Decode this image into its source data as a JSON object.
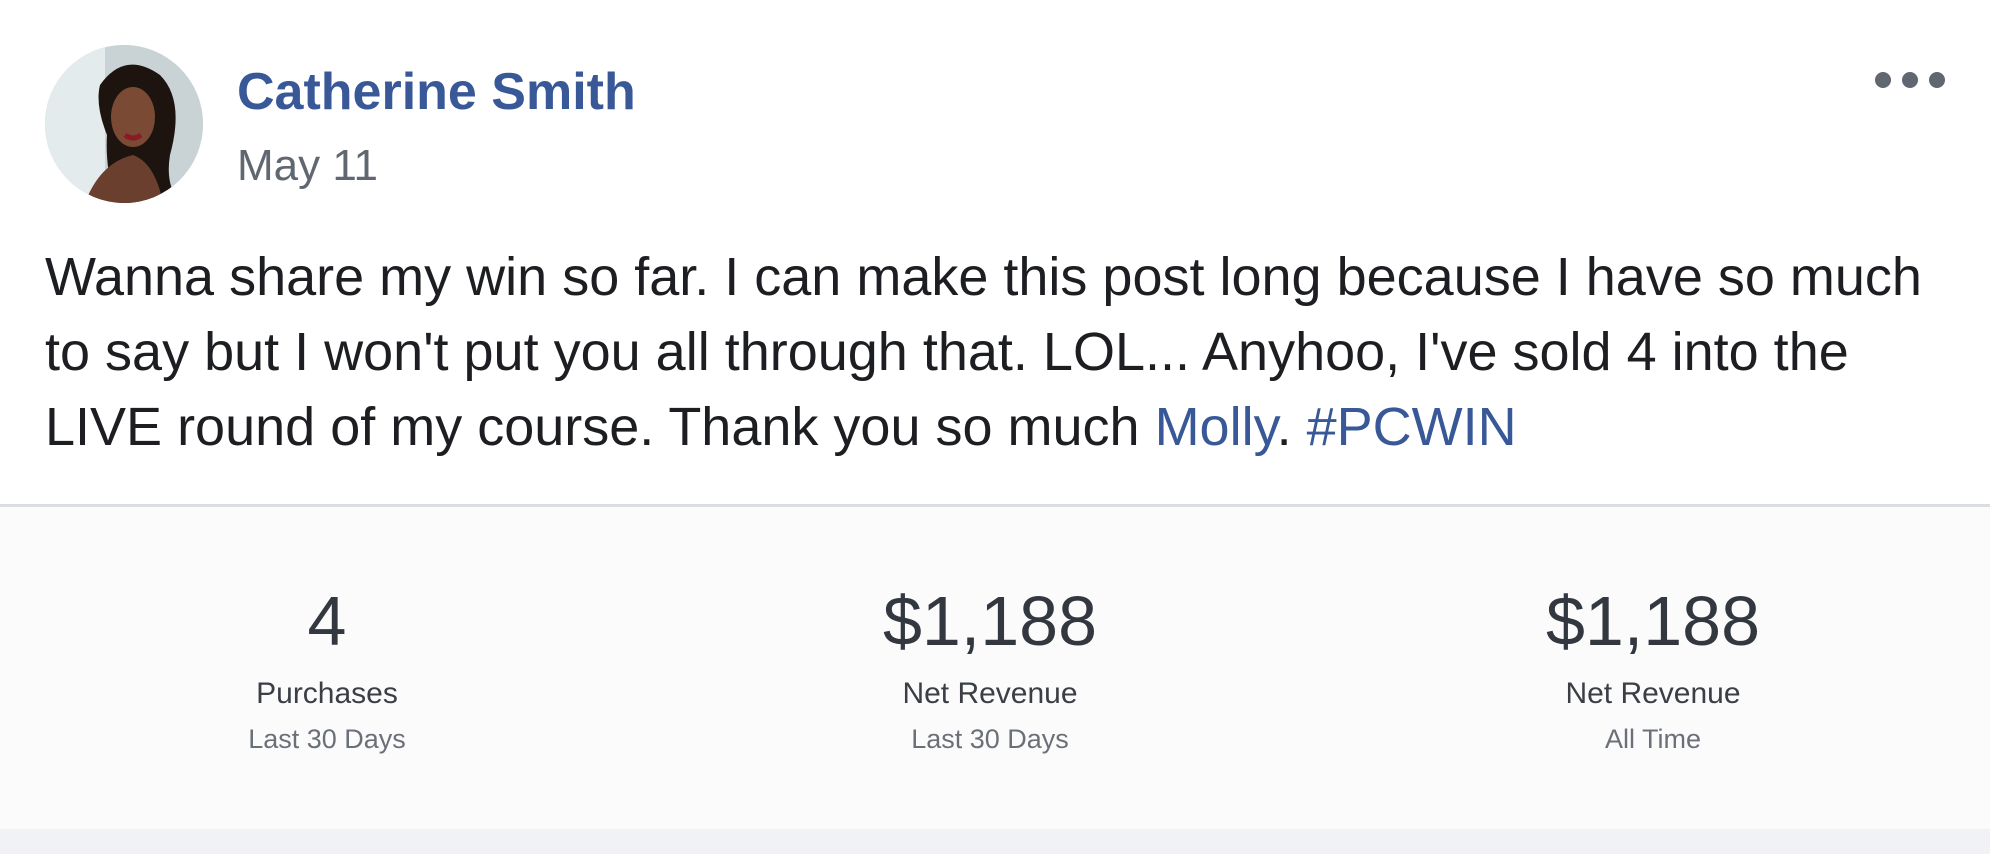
{
  "post": {
    "author": "Catherine Smith",
    "date": "May 11",
    "body_before_link": "Wanna share my win so far. I can make this post long because I have so much to say but I won't put you all through that. LOL... Anyhoo, I've sold 4 into the LIVE round of my course. Thank you so much ",
    "mention": "Molly",
    "body_between": ". ",
    "hashtag": "#PCWIN",
    "more_icon": "more-options-icon",
    "link_color": "#385898"
  },
  "stats": [
    {
      "value": "4",
      "label": "Purchases",
      "period": "Last 30 Days"
    },
    {
      "value": "$1,188",
      "label": "Net Revenue",
      "period": "Last 30 Days"
    },
    {
      "value": "$1,188",
      "label": "Net Revenue",
      "period": "All Time"
    }
  ]
}
